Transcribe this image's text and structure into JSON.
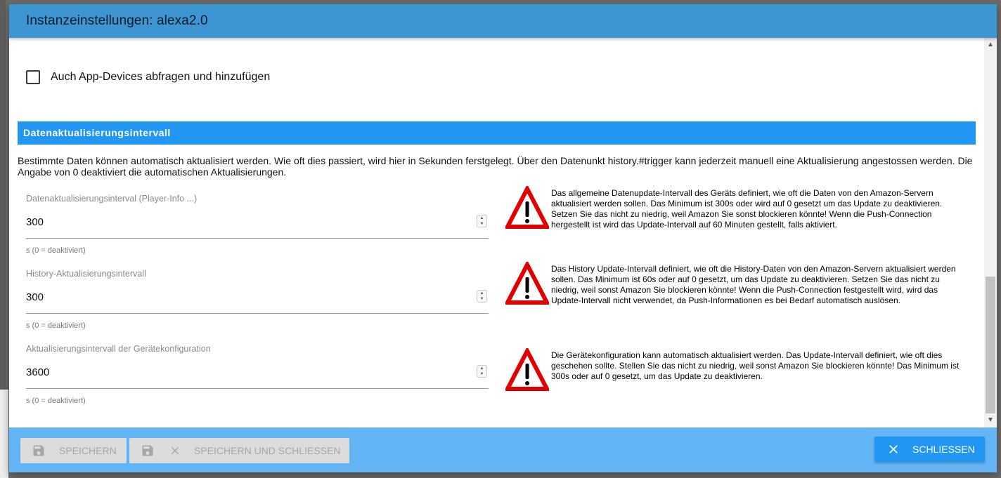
{
  "dialog": {
    "title": "Instanzeinstellungen: alexa2.0"
  },
  "checkbox": {
    "label": "Auch App-Devices abfragen und hinzufügen",
    "checked": false
  },
  "section": {
    "header": "Datenaktualisierungsintervall",
    "description": "Bestimmte Daten können automatisch aktualisiert werden. Wie oft dies passiert, wird hier in Sekunden ferstgelegt. Über den Datenunkt history.#trigger kann jederzeit manuell eine Aktualisierung angestossen werden. Die Angabe von 0 deaktiviert die automatischen Aktualisierungen."
  },
  "fields": [
    {
      "label": "Datenaktualisierungsinterval (Player-Info ...)",
      "value": "300",
      "helper": "s (0 = deaktiviert)",
      "warning": "Das allgemeine Datenupdate-Intervall des Geräts definiert, wie oft die Daten von den Amazon-Servern aktualisiert werden sollen. Das Minimum ist 300s oder wird auf 0 gesetzt um das Update zu deaktivieren. Setzen Sie das nicht zu niedrig, weil Amazon Sie sonst blockieren könnte! Wenn die Push-Connection hergestellt ist wird das Update-Intervall auf 60 Minuten gestellt, falls aktiviert."
    },
    {
      "label": "History-Aktualisierungsintervall",
      "value": "300",
      "helper": "s (0 = deaktiviert)",
      "warning": "Das History Update-Intervall definiert, wie oft die History-Daten von den Amazon-Servern aktualisiert werden sollen. Das Minimum ist 60s oder auf 0 gesetzt, um das Update zu deaktivieren. Setzen Sie das nicht zu niedrig, weil sonst Amazon Sie blockieren könnte! Wenn die Push-Connection festgestellt wird, wird das Update-Intervall nicht verwendet, da Push-Informationen es bei Bedarf automatisch auslösen."
    },
    {
      "label": "Aktualisierungsintervall der Gerätekonfiguration",
      "value": "3600",
      "helper": "s (0 = deaktiviert)",
      "warning": "Die Gerätekonfiguration kann automatisch aktualisiert werden. Das Update-Intervall definiert, wie oft dies geschehen sollte. Stellen Sie das nicht zu niedrig, weil sonst Amazon Sie blockieren könnte! Das Minimum ist 300s oder auf 0 gesetzt, um das Update zu deaktivieren."
    }
  ],
  "footer": {
    "save_label": "SPEICHERN",
    "save_close_label": "SPEICHERN UND SCHLIESSEN",
    "close_label": "SCHLIESSEN"
  },
  "icons": {
    "save": "floppy-disk-icon",
    "close": "close-x-icon",
    "warning": "warning-triangle-icon"
  },
  "colors": {
    "titlebar": "#3d95d1",
    "section_header": "#2196f3",
    "footer": "#64b5f6",
    "close_button": "#2196f3",
    "warning_red": "#e00000"
  }
}
